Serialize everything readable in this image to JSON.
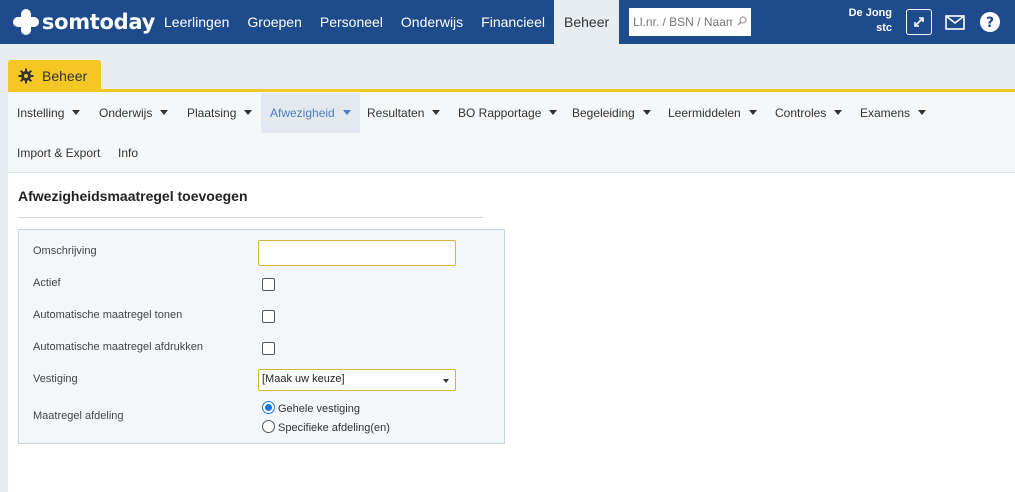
{
  "brand": {
    "name": "somtoday"
  },
  "nav": {
    "items": [
      "Leerlingen",
      "Groepen",
      "Personeel",
      "Onderwijs",
      "Financieel",
      "Beheer"
    ],
    "active": "Beheer"
  },
  "search": {
    "placeholder": "Ll.nr. / BSN / Naam"
  },
  "user": {
    "line1": "De Jong",
    "line2": "stc"
  },
  "icons": {
    "logo": "puzzle-cross-icon",
    "expand": "expand-icon",
    "mail": "mail-icon",
    "help": "help-icon",
    "gear": "gear-icon",
    "search": "search-icon"
  },
  "module": {
    "label": "Beheer"
  },
  "submenu": {
    "row1": [
      {
        "label": "Instelling",
        "caret": true
      },
      {
        "label": "Onderwijs",
        "caret": true
      },
      {
        "label": "Plaatsing",
        "caret": true
      },
      {
        "label": "Afwezigheid",
        "caret": true,
        "active": true
      },
      {
        "label": "Resultaten",
        "caret": true
      },
      {
        "label": "BO Rapportage",
        "caret": true
      },
      {
        "label": "Begeleiding",
        "caret": true
      },
      {
        "label": "Leermiddelen",
        "caret": true
      },
      {
        "label": "Controles",
        "caret": true
      },
      {
        "label": "Examens",
        "caret": true
      }
    ],
    "row2": [
      {
        "label": "Import & Export",
        "caret": false
      },
      {
        "label": "Info",
        "caret": false
      }
    ]
  },
  "page": {
    "title": "Afwezigheidsmaatregel toevoegen"
  },
  "form": {
    "omschrijving": {
      "label": "Omschrijving",
      "value": ""
    },
    "actief": {
      "label": "Actief",
      "checked": false
    },
    "auto_tonen": {
      "label": "Automatische maatregel tonen",
      "checked": false
    },
    "auto_afdrukken": {
      "label": "Automatische maatregel afdrukken",
      "checked": false
    },
    "vestiging": {
      "label": "Vestiging",
      "selected": "[Maak uw keuze]"
    },
    "afdeling": {
      "label": "Maatregel afdeling",
      "options": [
        "Gehele vestiging",
        "Specifieke afdeling(en)"
      ],
      "selected": "Gehele vestiging"
    }
  },
  "colors": {
    "topbar": "#1e4b8c",
    "accent": "#f4c724",
    "active_link": "#4a7fc1"
  }
}
